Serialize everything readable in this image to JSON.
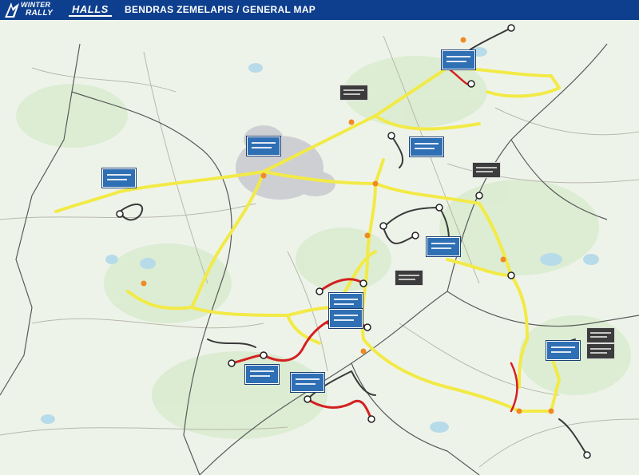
{
  "header": {
    "logo_rally_line1": "WINTER",
    "logo_rally_line2": "RALLY",
    "logo_halls": "HALLS",
    "title": "BENDRAS ZEMELAPIS / GENERAL MAP"
  },
  "colors": {
    "header_bg": "#0d3f8e",
    "liaison_route": "#f2ea46",
    "stage_route_red": "#d42020",
    "stage_route_dark": "#3a3a3a",
    "stage_label": "#2f6fb4",
    "service_label": "#3c3c3c",
    "map_background": "#eef3ea"
  },
  "icons": [
    "rally-logo-icon",
    "halls-logo-icon",
    "stage-marker-icon",
    "service-marker-icon"
  ],
  "map": {
    "stage_labels_count": 10,
    "service_labels_count": 5
  }
}
